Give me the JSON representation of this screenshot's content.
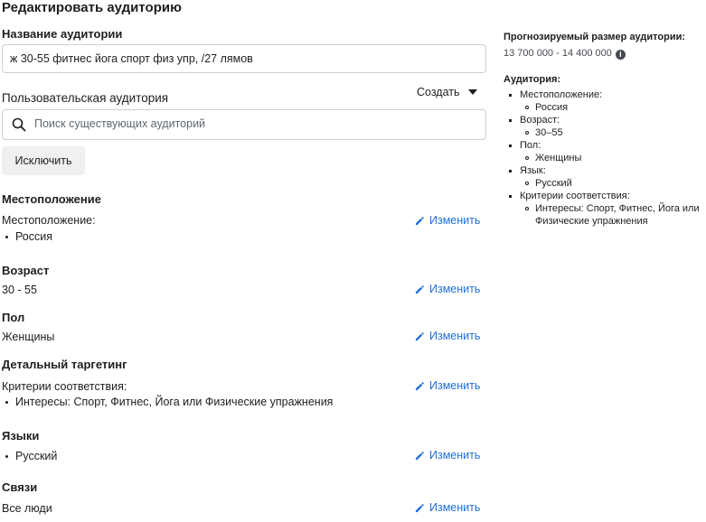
{
  "page": {
    "title": "Редактировать аудиторию"
  },
  "audience_name": {
    "label": "Название аудитории",
    "value": "ж 30-55 фитнес йога спорт физ упр, /27 лямов"
  },
  "custom_audience": {
    "label": "Пользовательская аудитория",
    "create_label": "Создать",
    "search_placeholder": "Поиск существующих аудиторий",
    "exclude_label": "Исключить"
  },
  "edit_label": "Изменить",
  "location": {
    "heading": "Местоположение",
    "sub": "Местоположение:",
    "items": [
      "Россия"
    ]
  },
  "age": {
    "heading": "Возраст",
    "value": "30 - 55"
  },
  "gender": {
    "heading": "Пол",
    "value": "Женщины"
  },
  "detailed_targeting": {
    "heading": "Детальный таргетинг",
    "sub": "Критерии соответствия:",
    "items": [
      "Интересы: Спорт, Фитнес, Йога или Физические упражнения"
    ]
  },
  "languages": {
    "heading": "Языки",
    "items": [
      "Русский"
    ]
  },
  "connections": {
    "heading": "Связи",
    "value": "Все люди"
  },
  "summary": {
    "size_label": "Прогнозируемый размер аудитории:",
    "size_value": "13 700 000 - 14 400 000",
    "audience_label": "Аудитория:",
    "location_label": "Местоположение:",
    "location_value": "Россия",
    "age_label": "Возраст:",
    "age_value": "30–55",
    "gender_label": "Пол:",
    "gender_value": "Женщины",
    "language_label": "Язык:",
    "language_value": "Русский",
    "criteria_label": "Критерии соответствия:",
    "criteria_value": "Интересы: Спорт, Фитнес, Йога или Физические упражнения"
  },
  "icons": {
    "search": "search-icon",
    "edit": "pencil-icon",
    "info": "info-icon",
    "caret": "caret-down-icon"
  },
  "colors": {
    "link": "#216fdb",
    "button_bg": "#f0f0f0",
    "border": "#ccd0d5"
  }
}
